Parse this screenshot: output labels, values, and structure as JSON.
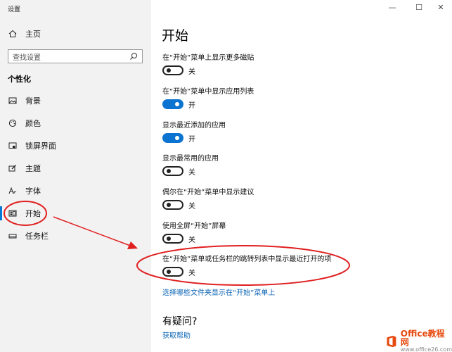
{
  "window": {
    "title": "设置",
    "controls": {
      "minimize": "—",
      "maximize": "☐",
      "close": "✕"
    }
  },
  "sidebar": {
    "home_label": "主页",
    "search_placeholder": "查找设置",
    "section_title": "个性化",
    "items": [
      {
        "label": "背景",
        "icon": "picture-icon"
      },
      {
        "label": "颜色",
        "icon": "palette-icon"
      },
      {
        "label": "锁屏界面",
        "icon": "lock-screen-icon"
      },
      {
        "label": "主题",
        "icon": "brush-icon"
      },
      {
        "label": "字体",
        "icon": "font-icon"
      },
      {
        "label": "开始",
        "icon": "start-icon",
        "active": true
      },
      {
        "label": "任务栏",
        "icon": "taskbar-icon"
      }
    ]
  },
  "main": {
    "title": "开始",
    "settings": [
      {
        "label": "在“开始”菜单上显示更多磁贴",
        "state": "关",
        "on": false
      },
      {
        "label": "在“开始”菜单中显示应用列表",
        "state": "开",
        "on": true
      },
      {
        "label": "显示最近添加的应用",
        "state": "开",
        "on": true
      },
      {
        "label": "显示最常用的应用",
        "state": "关",
        "on": false
      },
      {
        "label": "偶尔在“开始”菜单中显示建议",
        "state": "关",
        "on": false
      },
      {
        "label": "使用全屏“开始”屏幕",
        "state": "关",
        "on": false
      },
      {
        "label": "在“开始”菜单或任务栏的跳转列表中显示最近打开的项",
        "state": "关",
        "on": false
      }
    ],
    "folders_link": "选择哪些文件夹显示在“开始”菜单上",
    "help_heading": "有疑问?",
    "help_link": "获取帮助"
  },
  "watermark": {
    "brand": "Office教程网",
    "url": "www.office26.com"
  },
  "colors": {
    "accent": "#0a74d0",
    "annotation": "#e02020",
    "sidebar_bg": "#f2f2f2"
  }
}
